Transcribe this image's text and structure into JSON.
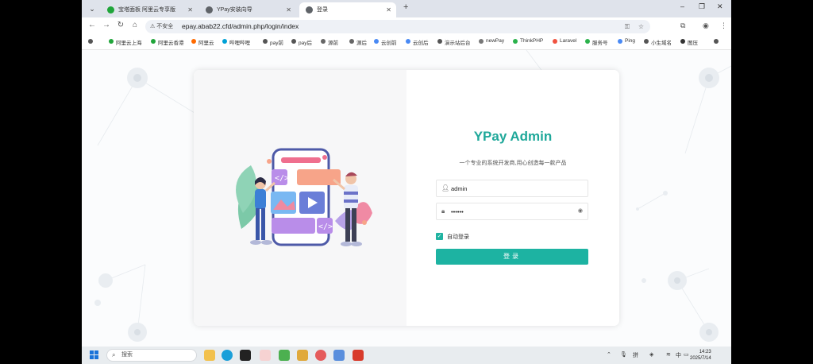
{
  "browser": {
    "tabs": [
      {
        "title": "宝塔面板 阿里云专享版",
        "favicon_color": "#20a53a",
        "active": false
      },
      {
        "title": "YPay安装向导",
        "favicon_color": "#5f6368",
        "active": false
      },
      {
        "title": "登录",
        "favicon_color": "#5f6368",
        "active": true
      }
    ],
    "new_tab": "+",
    "window_controls": [
      "–",
      "❐",
      "✕"
    ],
    "insecure_label": "不安全",
    "url": "epay.abab22.cfd/admin.php/login/index",
    "bookmarks": [
      {
        "label": "阿里云上海",
        "color": "#20a53a"
      },
      {
        "label": "阿里云香港",
        "color": "#20a53a"
      },
      {
        "label": "阿里云",
        "color": "#ff6a00"
      },
      {
        "label": "哔哩哔哩",
        "color": "#00a1d6"
      },
      {
        "label": "pay前",
        "color": "#555555"
      },
      {
        "label": "pay后",
        "color": "#555555"
      },
      {
        "label": "源前",
        "color": "#666666"
      },
      {
        "label": "源后",
        "color": "#666666"
      },
      {
        "label": "云创前",
        "color": "#4a8af4"
      },
      {
        "label": "云创后",
        "color": "#4a8af4"
      },
      {
        "label": "演示站后台",
        "color": "#555555"
      },
      {
        "label": "newPay",
        "color": "#777777"
      },
      {
        "label": "ThinkPHP",
        "color": "#2bb24c"
      },
      {
        "label": "Laravel",
        "color": "#f05340"
      },
      {
        "label": "服务号",
        "color": "#2bb24c"
      },
      {
        "label": "Ping",
        "color": "#4a8af4"
      },
      {
        "label": "小生域名",
        "color": "#555555"
      },
      {
        "label": "图压",
        "color": "#333333"
      }
    ]
  },
  "login": {
    "title": "YPay Admin",
    "subtitle": "一个专业的系统开发商,用心创造每一款产品",
    "username_value": "admin",
    "password_value": "••••••",
    "remember_label": "自动登录",
    "remember_checked": true,
    "submit_label": "登录",
    "accent": "#1db3a2"
  },
  "taskbar": {
    "search_placeholder": "搜索",
    "time": "14:23",
    "date": "2025/7/14",
    "ime": "中",
    "lang": "拼"
  }
}
